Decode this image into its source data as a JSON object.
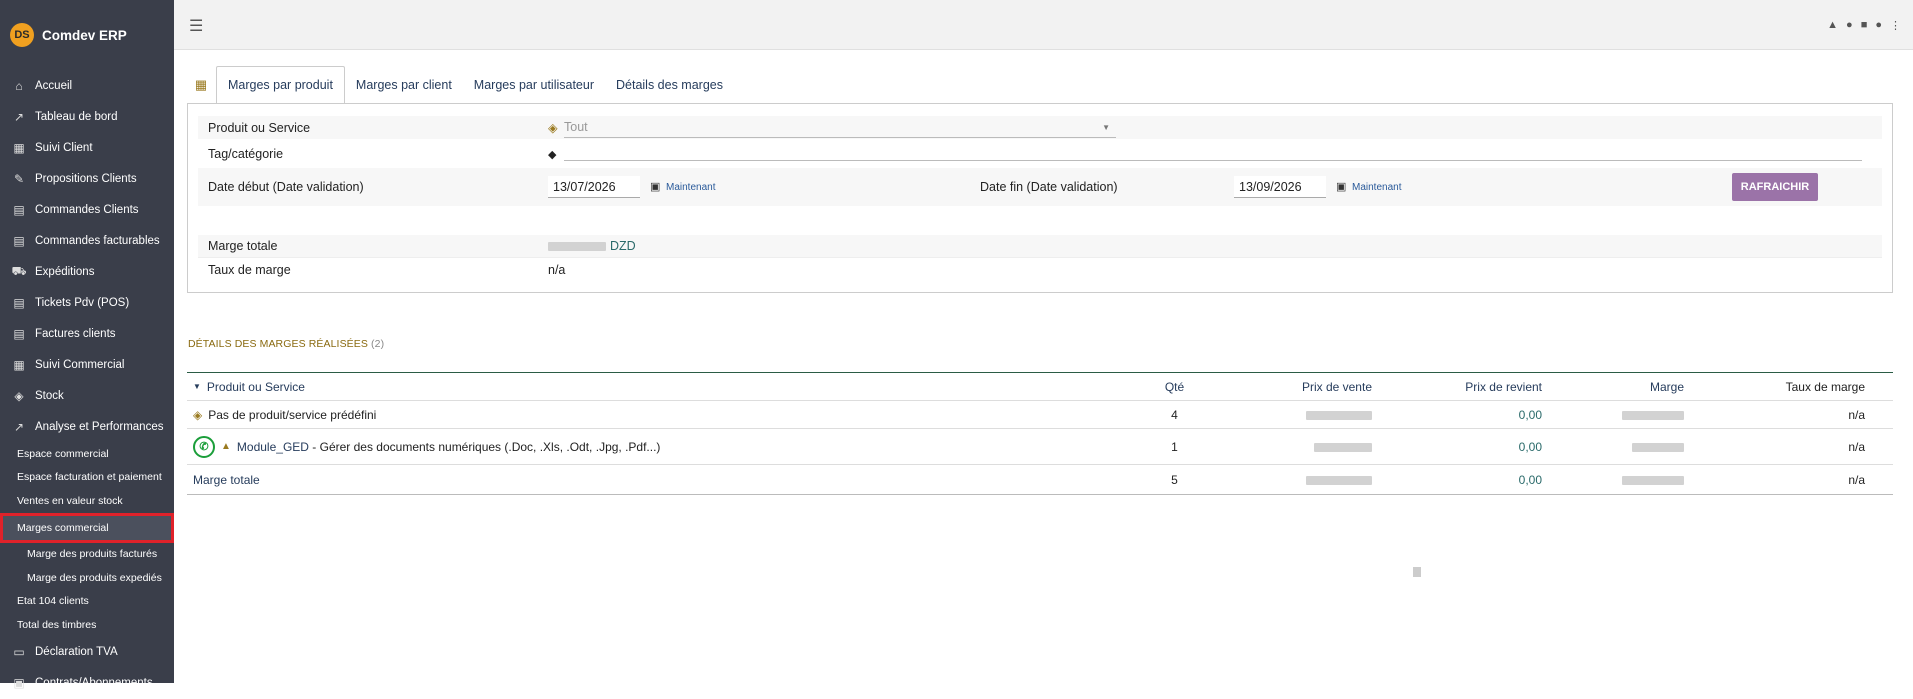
{
  "brand": {
    "logo": "DS",
    "title": "Comdev ERP"
  },
  "sidebar": {
    "items": [
      {
        "icon": "home-icon",
        "glyph": "⌂",
        "label": "Accueil"
      },
      {
        "icon": "chart-line-icon",
        "glyph": "↗",
        "label": "Tableau de bord"
      },
      {
        "icon": "building-icon",
        "glyph": "▦",
        "label": "Suivi Client"
      },
      {
        "icon": "file-edit-icon",
        "glyph": "✎",
        "label": "Propositions Clients"
      },
      {
        "icon": "file-icon",
        "glyph": "▤",
        "label": "Commandes Clients"
      },
      {
        "icon": "file-icon",
        "glyph": "▤",
        "label": "Commandes facturables"
      },
      {
        "icon": "dolly-icon",
        "glyph": "⛟",
        "label": "Expéditions"
      },
      {
        "icon": "file-icon",
        "glyph": "▤",
        "label": "Tickets Pdv (POS)"
      },
      {
        "icon": "invoice-icon",
        "glyph": "▤",
        "label": "Factures clients"
      },
      {
        "icon": "building-icon",
        "glyph": "▦",
        "label": "Suivi Commercial"
      },
      {
        "icon": "box-icon",
        "glyph": "◈",
        "label": "Stock"
      },
      {
        "icon": "chart-line-icon",
        "glyph": "↗",
        "label": "Analyse et Performances"
      }
    ],
    "sub_items": [
      {
        "label": "Espace commercial"
      },
      {
        "label": "Espace facturation et paiement"
      },
      {
        "label": "Ventes en valeur stock"
      },
      {
        "label": "Marges commercial"
      }
    ],
    "sub_sub_items": [
      {
        "label": "Marge des produits facturés"
      },
      {
        "label": "Marge des produits expediés"
      }
    ],
    "more_items": [
      {
        "label": "Etat 104 clients"
      },
      {
        "label": "Total des timbres"
      }
    ],
    "bottom_items": [
      {
        "icon": "id-card-icon",
        "glyph": "▭",
        "label": "Déclaration TVA"
      },
      {
        "icon": "briefcase-icon",
        "glyph": "▣",
        "label": "Contrats/Abonnements"
      }
    ]
  },
  "tabs": [
    {
      "label": "Marges par produit"
    },
    {
      "label": "Marges par client"
    },
    {
      "label": "Marges par utilisateur"
    },
    {
      "label": "Détails des marges"
    }
  ],
  "filters": {
    "product_label": "Produit ou Service",
    "product_placeholder": "Tout",
    "tag_label": "Tag/catégorie",
    "start_label": "Date début (Date validation)",
    "start_value": "13/07/2026",
    "end_label": "Date fin (Date validation)",
    "end_value": "13/09/2026",
    "now_label": "Maintenant",
    "refresh_label": "RAFRAICHIR"
  },
  "summary": {
    "total_label": "Marge totale",
    "total_currency": "DZD",
    "rate_label": "Taux de marge",
    "rate_value": "n/a"
  },
  "details": {
    "title": "DÉTAILS DES MARGES RÉALISÉES",
    "count": "(2)",
    "columns": [
      "Produit ou Service",
      "Qté",
      "Prix de vente",
      "Prix de revient",
      "Marge",
      "Taux de marge"
    ],
    "rows": [
      {
        "product": "Pas de produit/service prédéfini",
        "qty": "4",
        "cost": "0,00",
        "rate": "n/a"
      },
      {
        "ref": "Module_GED",
        "desc": " - Gérer des documents numériques (.Doc, .Xls, .Odt, .Jpg, .Pdf...)",
        "qty": "1",
        "cost": "0,00",
        "rate": "n/a"
      }
    ],
    "total": {
      "label": "Marge totale",
      "qty": "5",
      "cost": "0,00",
      "rate": "n/a"
    }
  }
}
